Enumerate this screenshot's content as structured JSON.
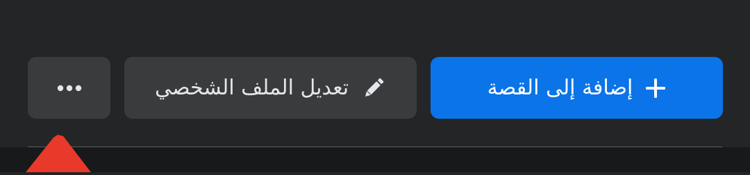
{
  "profile_actions": {
    "add_to_story": {
      "label": "إضافة إلى القصة",
      "icon": "plus-icon",
      "color": "#0a74e8"
    },
    "edit_profile": {
      "label": "تعديل الملف الشخصي",
      "icon": "pencil-icon"
    },
    "more": {
      "icon": "more-icon"
    }
  }
}
